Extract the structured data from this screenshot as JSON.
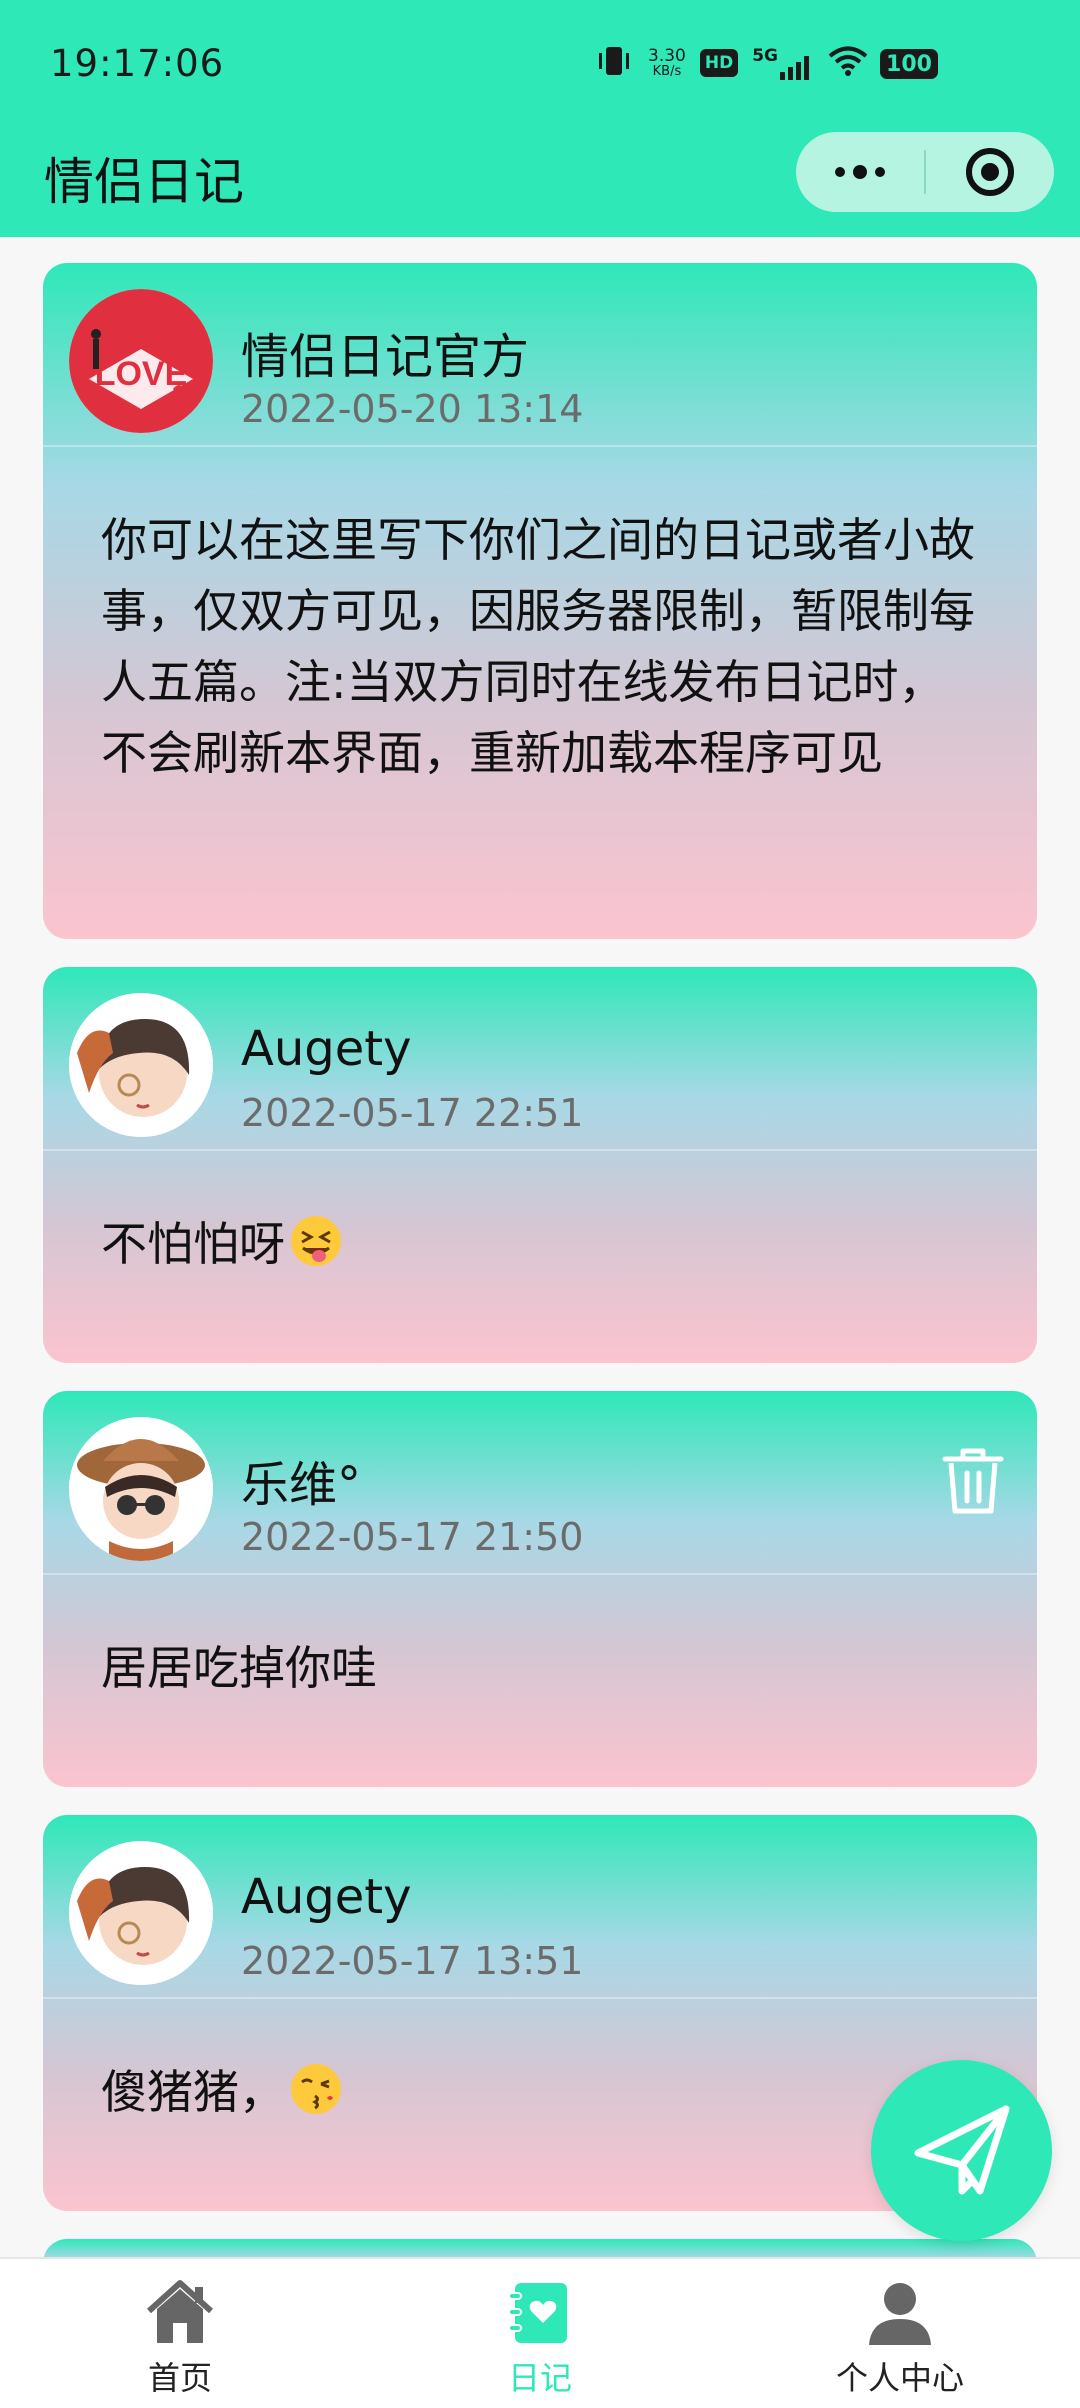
{
  "status_bar": {
    "time": "19:17:06",
    "net_speed": "3.30",
    "net_unit": "KB/s",
    "hd": "HD",
    "network": "5G",
    "battery": "100"
  },
  "nav": {
    "title": "情侣日记"
  },
  "posts": [
    {
      "author": "情侣日记官方",
      "date": "2022-05-20 13:14",
      "content": "你可以在这里写下你们之间的日记或者小故事，仅双方可见，因服务器限制，暂限制每人五篇。注:当双方同时在线发布日记时，不会刷新本界面，重新加载本程序可见",
      "emoji": "",
      "avatar_icon": "love-logo-avatar",
      "deletable": false
    },
    {
      "author": "Augety",
      "date": "2022-05-17 22:51",
      "content": "不怕怕呀",
      "emoji": "squinting-tongue-emoji",
      "avatar_icon": "cartoon-boy-avatar",
      "deletable": false
    },
    {
      "author": "乐维°",
      "date": "2022-05-17 21:50",
      "content": "居居吃掉你哇",
      "emoji": "",
      "avatar_icon": "cartoon-boy-hat-avatar",
      "deletable": true
    },
    {
      "author": "Augety",
      "date": "2022-05-17 13:51",
      "content": "傻猪猪，",
      "emoji": "kissing-emoji",
      "avatar_icon": "cartoon-boy-avatar",
      "deletable": false
    }
  ],
  "tabbar": {
    "items": [
      {
        "label": "首页",
        "icon": "home-icon"
      },
      {
        "label": "日记",
        "icon": "diary-icon",
        "active": true
      },
      {
        "label": "个人中心",
        "icon": "profile-icon"
      }
    ]
  },
  "colors": {
    "accent": "#2ee8b8",
    "card_top": "#2ee8b8",
    "card_bottom": "#fbc4cf",
    "date_text": "#6b6b6b"
  }
}
